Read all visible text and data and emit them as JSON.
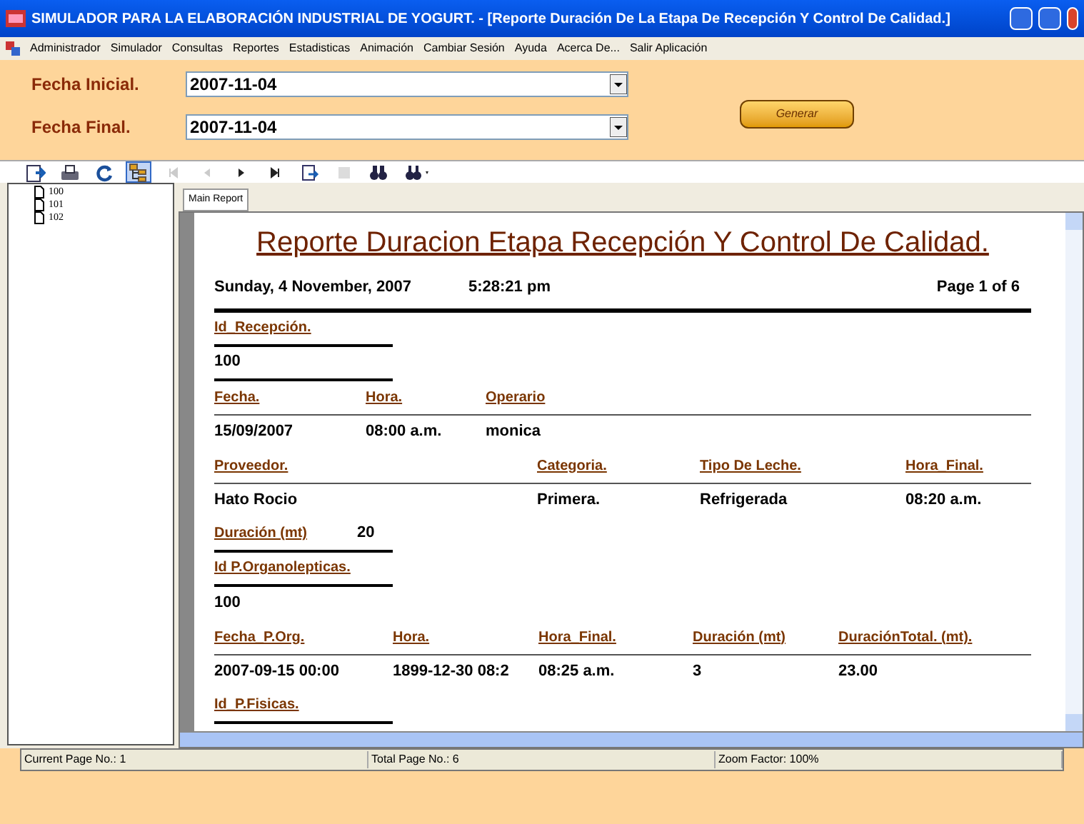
{
  "window": {
    "title": "SIMULADOR PARA LA ELABORACIÓN INDUSTRIAL DE YOGURT. - [Reporte Duración De La Etapa De Recepción Y Control De Calidad.]"
  },
  "menu": [
    "Administrador",
    "Simulador",
    "Consultas",
    "Reportes",
    "Estadisticas",
    "Animación",
    "Cambiar Sesión",
    "Ayuda",
    "Acerca De...",
    "Salir Aplicación"
  ],
  "form": {
    "fields": [
      {
        "label": "Fecha Inicial.",
        "value": "2007-11-04"
      },
      {
        "label": "Fecha Final.",
        "value": "2007-11-04"
      }
    ],
    "button": "Generar"
  },
  "toolbar": [
    {
      "kind": "export",
      "selected": false,
      "disabled": false
    },
    {
      "kind": "print",
      "selected": false,
      "disabled": false
    },
    {
      "kind": "refresh",
      "selected": false,
      "disabled": false
    },
    {
      "kind": "tree",
      "selected": true,
      "disabled": false
    },
    {
      "kind": "first",
      "selected": false,
      "disabled": true
    },
    {
      "kind": "prev",
      "selected": false,
      "disabled": true
    },
    {
      "kind": "next",
      "selected": false,
      "disabled": false
    },
    {
      "kind": "last",
      "selected": false,
      "disabled": false
    },
    {
      "kind": "goto",
      "selected": false,
      "disabled": false
    },
    {
      "kind": "stop",
      "selected": false,
      "disabled": true
    },
    {
      "kind": "search",
      "selected": false,
      "disabled": false
    },
    {
      "kind": "zoom",
      "selected": false,
      "disabled": false
    }
  ],
  "tree": [
    "100",
    "101",
    "102"
  ],
  "tab": "Main Report",
  "report": {
    "title": "Reporte Duracion Etapa Recepción Y Control De Calidad.",
    "date": "Sunday, 4 November, 2007",
    "time": "5:28:21 pm",
    "page": "Page 1 of 6",
    "rows": [
      {
        "kind": "label",
        "rule": true,
        "wide": false,
        "cells": [
          "Id_Recepción."
        ]
      },
      {
        "kind": "value",
        "rule": true,
        "wide": false,
        "cells": [
          "100"
        ]
      },
      {
        "kind": "label",
        "rule": true,
        "wide": true,
        "cells": [
          "Fecha.",
          "Hora.",
          "Operario"
        ]
      },
      {
        "kind": "value",
        "rule": false,
        "cells": [
          "15/09/2007",
          "08:00 a.m.",
          "monica"
        ]
      },
      {
        "kind": "label",
        "rule": true,
        "wide": true,
        "cells": [
          "Proveedor.",
          "Categoria.",
          "Tipo De Leche.",
          "Hora_Final."
        ]
      },
      {
        "kind": "value",
        "rule": false,
        "cells": [
          "Hato Rocio",
          "Primera.",
          "Refrigerada",
          "08:20 a.m."
        ]
      },
      {
        "kind": "pair",
        "rule": true,
        "wide": false,
        "cells": [
          "Duración (mt)",
          "20"
        ]
      },
      {
        "kind": "label",
        "rule": true,
        "wide": false,
        "cells": [
          "Id P.Organolepticas."
        ]
      },
      {
        "kind": "value",
        "rule": false,
        "cells": [
          "100"
        ]
      },
      {
        "kind": "label",
        "rule": true,
        "wide": true,
        "cells": [
          "Fecha_P.Org.",
          "Hora.",
          "Hora_Final.",
          "Duración (mt)",
          "DuraciónTotal. (mt)."
        ]
      },
      {
        "kind": "value",
        "rule": false,
        "cells": [
          "2007-09-15 00:00",
          "1899-12-30 08:2",
          "08:25 a.m.",
          "3",
          "23.00"
        ]
      },
      {
        "kind": "label",
        "rule": true,
        "wide": false,
        "cells": [
          "Id_P.Fisicas."
        ]
      }
    ]
  },
  "status": [
    "Current Page No.: 1",
    "Total Page No.: 6",
    "Zoom Factor: 100%"
  ]
}
